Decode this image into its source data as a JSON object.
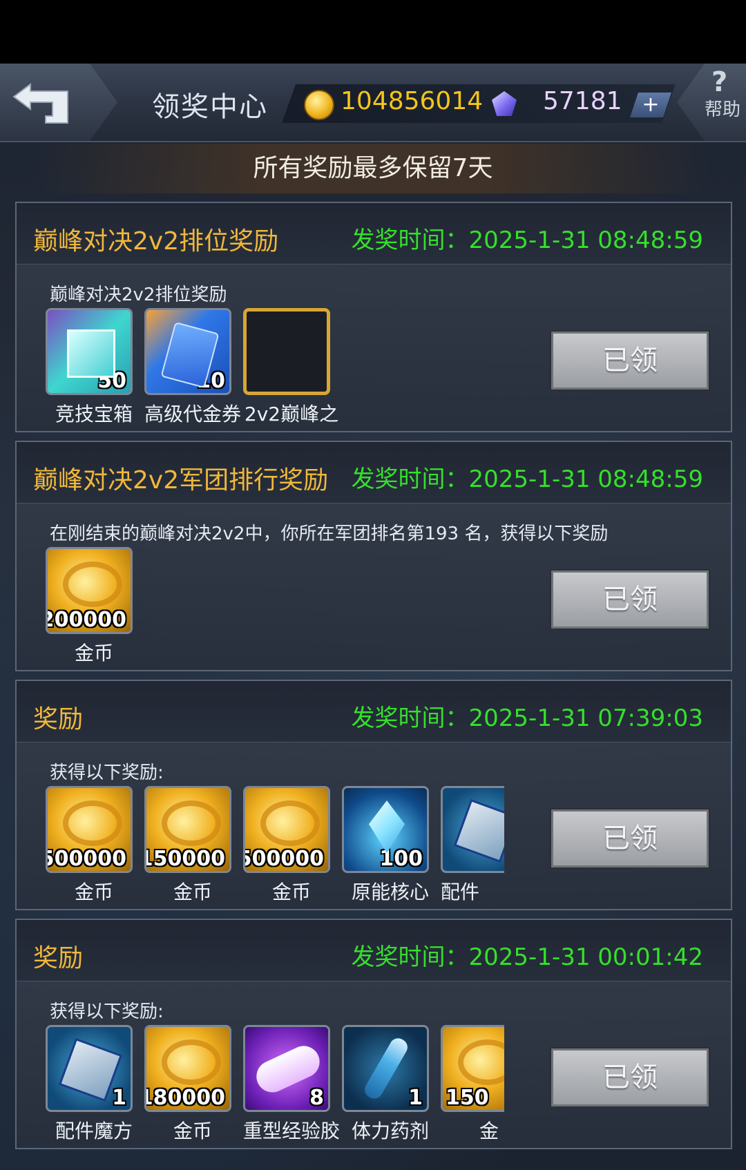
{
  "header": {
    "title": "领奖中心",
    "coins": "104856014",
    "gems": "57181",
    "plus_label": "+",
    "help_symbol": "?",
    "help_label": "帮助"
  },
  "notice": "所有奖励最多保留7天",
  "claimed_label": "已领",
  "cards": [
    {
      "title": "巅峰对决2v2排位奖励",
      "time": "发奖时间：2025-1-31 08:48:59",
      "desc": "巅峰对决2v2排位奖励",
      "items": [
        {
          "name": "竞技宝箱",
          "count": "50",
          "icon": "teal-gift-box"
        },
        {
          "name": "高级代金券",
          "count": "10",
          "icon": "voucher-cards"
        },
        {
          "name": "2v2巅峰之",
          "count": "",
          "icon": "golden-frame"
        }
      ]
    },
    {
      "title": "巅峰对决2v2军团排行奖励",
      "time": "发奖时间：2025-1-31 08:48:59",
      "desc": "在刚结束的巅峰对决2v2中，你所在军团排名第193 名，获得以下奖励",
      "items": [
        {
          "name": "金币",
          "count": "200000",
          "icon": "gold-coins"
        }
      ]
    },
    {
      "title": "奖励",
      "time": "发奖时间：2025-1-31 07:39:03",
      "desc": "获得以下奖励:",
      "items": [
        {
          "name": "金币",
          "count": "500000",
          "icon": "gold-coins"
        },
        {
          "name": "金币",
          "count": "150000",
          "icon": "gold-coins"
        },
        {
          "name": "金币",
          "count": "500000",
          "icon": "gold-coins"
        },
        {
          "name": "原能核心",
          "count": "100",
          "icon": "crystal"
        },
        {
          "name": "配件",
          "count": "",
          "icon": "cube"
        }
      ]
    },
    {
      "title": "奖励",
      "time": "发奖时间：2025-1-31 00:01:42",
      "desc": "获得以下奖励:",
      "items": [
        {
          "name": "配件魔方",
          "count": "1",
          "icon": "cube"
        },
        {
          "name": "金币",
          "count": "180000",
          "icon": "gold-coins"
        },
        {
          "name": "重型经验胶",
          "count": "8",
          "icon": "exp-capsule"
        },
        {
          "name": "体力药剂",
          "count": "1",
          "icon": "potion"
        },
        {
          "name": "金",
          "count": "150",
          "icon": "gold-coins"
        }
      ]
    }
  ]
}
